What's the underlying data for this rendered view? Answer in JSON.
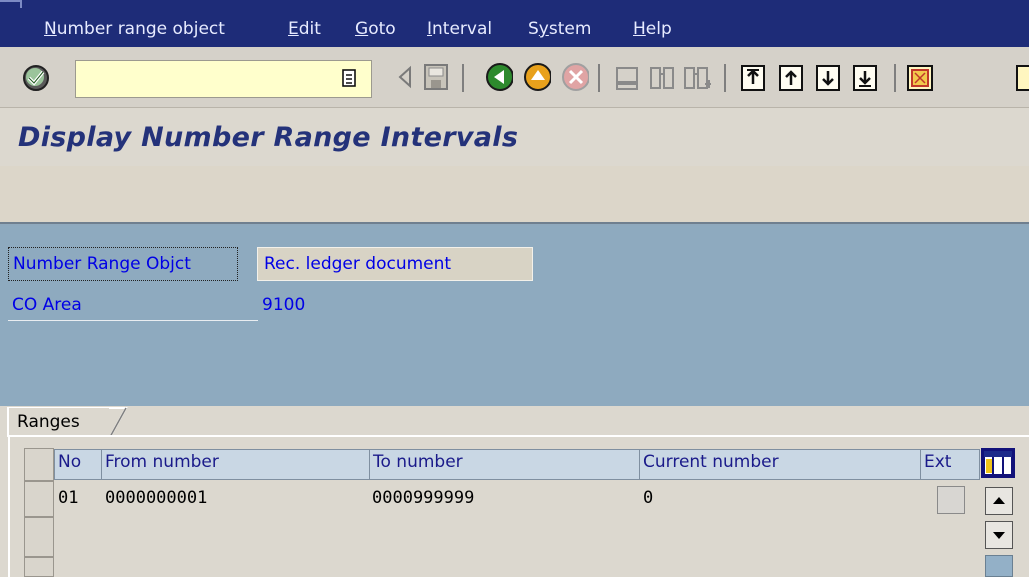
{
  "menu": {
    "items": [
      "Number range object",
      "Edit",
      "Goto",
      "Interval",
      "System",
      "Help"
    ],
    "accelerators": [
      "N",
      "E",
      "G",
      "I",
      "y",
      "H"
    ]
  },
  "toolbar": {
    "command_value": ""
  },
  "title": "Display Number Range Intervals",
  "header": {
    "nro_label": "Number Range Objct",
    "nro_value": "Rec. ledger document",
    "co_label": "CO Area",
    "co_value": "9100"
  },
  "tabs": {
    "ranges": "Ranges"
  },
  "table": {
    "columns": [
      "No",
      "From number",
      "To number",
      "Current number",
      "Ext"
    ],
    "rows": [
      {
        "no": "01",
        "from": "0000000001",
        "to": "0000999999",
        "current": "0"
      }
    ]
  },
  "icons": [
    "enter-icon",
    "command-history-icon",
    "back-arrow-icon",
    "save-icon",
    "back-icon",
    "exit-icon",
    "cancel-icon",
    "print-icon",
    "find-icon",
    "find-next-icon",
    "first-page-icon",
    "previous-page-icon",
    "next-page-icon",
    "last-page-icon",
    "create-session-icon"
  ],
  "colors": {
    "menubar": "#1e2c78",
    "title": "#24327a",
    "label": "#0000e6",
    "body": "#8eaabf"
  }
}
